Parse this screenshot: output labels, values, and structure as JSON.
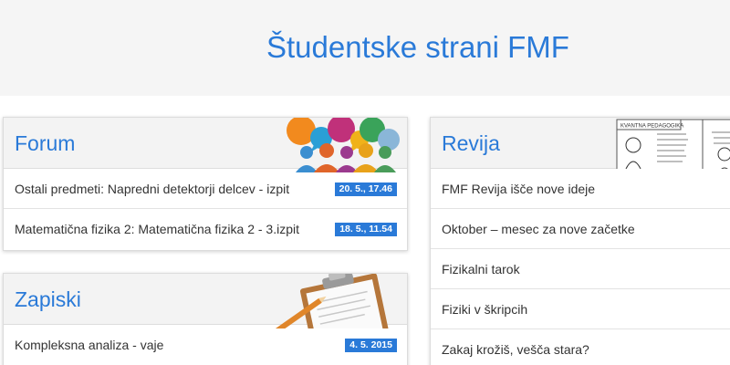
{
  "header": {
    "title": "Študentske strani FMF"
  },
  "forum": {
    "title": "Forum",
    "items": [
      {
        "text": "Ostali predmeti: Napredni detektorji delcev - izpit",
        "date": "20. 5., 17.46"
      },
      {
        "text": "Matematična fizika 2: Matematična fizika 2 - 3.izpit",
        "date": "18. 5., 11.54"
      }
    ]
  },
  "zapiski": {
    "title": "Zapiski",
    "items": [
      {
        "text": "Kompleksna analiza - vaje",
        "date": "4. 5. 2015"
      }
    ]
  },
  "revija": {
    "title": "Revija",
    "comic_title": "KVANTNA PEDAGOGIKA",
    "items": [
      {
        "text": "FMF Revija išče nove ideje"
      },
      {
        "text": "Oktober – mesec za nove začetke"
      },
      {
        "text": "Fizikalni tarok"
      },
      {
        "text": "Fiziki v škripcih"
      },
      {
        "text": "Zakaj krožiš, veščа stara?"
      }
    ]
  },
  "colors": {
    "accent": "#2a7ad8",
    "header_bg": "#f5f5f5",
    "panel_head_bg": "#f3f3f3"
  }
}
